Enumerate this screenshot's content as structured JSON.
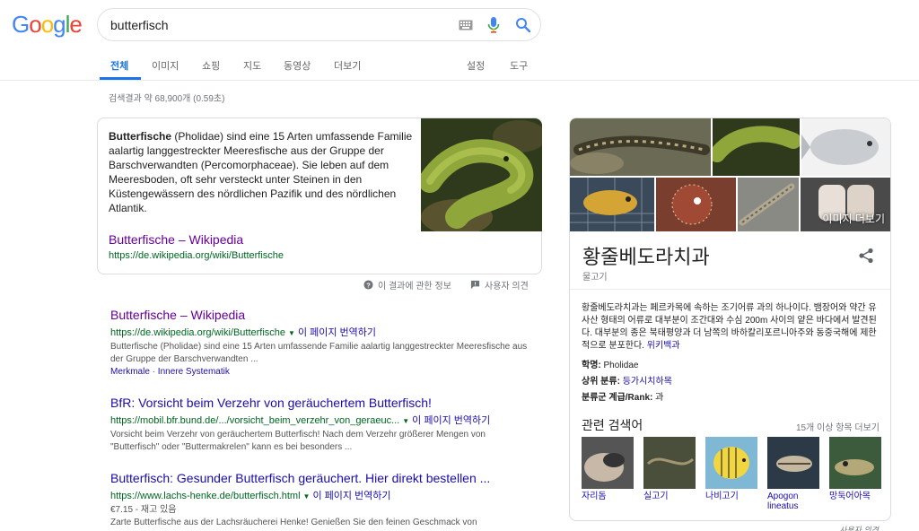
{
  "header": {
    "logo_letters": [
      {
        "ch": "G",
        "color": "#4285F4"
      },
      {
        "ch": "o",
        "color": "#EA4335"
      },
      {
        "ch": "o",
        "color": "#FBBC05"
      },
      {
        "ch": "g",
        "color": "#4285F4"
      },
      {
        "ch": "l",
        "color": "#34A853"
      },
      {
        "ch": "e",
        "color": "#EA4335"
      }
    ],
    "search_value": "butterfisch"
  },
  "tabs": {
    "all": "전체",
    "images": "이미지",
    "shopping": "쇼핑",
    "maps": "지도",
    "videos": "동영상",
    "more": "더보기",
    "settings": "설정",
    "tools": "도구"
  },
  "result_stats": "검색결과 약 68,900개 (0.59초)",
  "featured_snippet": {
    "bold_term": "Butterfische",
    "text": " (Pholidae) sind eine 15 Arten umfassende Familie aalartig langgestreckter Meeresfische aus der Gruppe der Barschverwandten (Percomorphaceae). Sie leben auf dem Meeresboden, oft sehr versteckt unter Steinen in den Küstengewässern des nördlichen Pazifik und des nördlichen Atlantik.",
    "link_title": "Butterfische – Wikipedia",
    "url": "https://de.wikipedia.org/wiki/Butterfische",
    "about_label": "이 결과에 관한 정보",
    "feedback_label": "사용자 의견"
  },
  "results": [
    {
      "title": "Butterfische – Wikipedia",
      "url": "https://de.wikipedia.org/wiki/Butterfische",
      "translate": "이 페이지 번역하기",
      "snippet": "Butterfische (Pholidae) sind eine 15 Arten umfassende Familie aalartig langgestreckter Meeresfische aus der Gruppe der Barschverwandten ...",
      "sitelink1": "Merkmale",
      "sitelink2": "Innere Systematik"
    },
    {
      "title": "BfR: Vorsicht beim Verzehr von geräuchertem Butterfisch!",
      "url": "https://mobil.bfr.bund.de/.../vorsicht_beim_verzehr_von_geraeuc...",
      "translate": "이 페이지 번역하기",
      "snippet": "Vorsicht beim Verzehr von geräuchertem Butterfisch! Nach dem Verzehr größerer Mengen von \"Butterfisch\" oder \"Buttermakrelen\" kann es bei besonders ..."
    },
    {
      "title": "Butterfisch: Gesunder Butterfisch geräuchert. Hier direkt bestellen ...",
      "url": "https://www.lachs-henke.de/butterfisch.html",
      "translate": "이 페이지 번역하기",
      "price": "€7.15 - 재고 있음",
      "snippet": "Zarte Butterfische aus der Lachsräucherei Henke! Genießen Sie den feinen Geschmack von"
    }
  ],
  "knowledge_panel": {
    "more_images": "이미지 더보기",
    "title": "황줄베도라치과",
    "subtitle": "물고기",
    "description": "황줄베도라치과는 페르카목에 속하는 조기어류 과의 하나이다. 뱀장어와 약간 유사산 형태의 어류로 대부분이 조간대와 수심 200m 사이의 얕은 바다에서 발견된다. 대부분의 종은 북태평양과 더 남쪽의 바하칼리포르니아주와 동중국해에 제한적으로 분포한다.",
    "wiki_link": "위키백과",
    "fact1_label": "학명",
    "fact1_value": "Pholidae",
    "fact2_label": "상위 분류",
    "fact2_value": "등가시치하목",
    "fact3_label": "분류군 계급/Rank",
    "fact3_value": "과",
    "related_heading": "관련 검색어",
    "related_more": "15개 이상 항목 더보기",
    "related": [
      {
        "label": "자리돔"
      },
      {
        "label": "실고기"
      },
      {
        "label": "나비고기"
      },
      {
        "label": "Apogon lineatus"
      },
      {
        "label": "망둑어아목"
      }
    ],
    "feedback": "사용자 의견"
  }
}
